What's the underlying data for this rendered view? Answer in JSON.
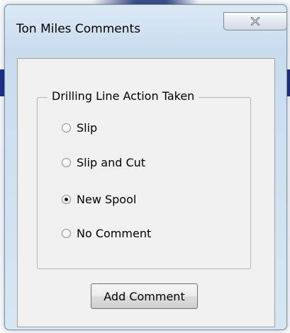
{
  "window": {
    "title": "Ton Miles Comments",
    "close_icon": "close-icon"
  },
  "group": {
    "label": "Drilling Line Action Taken",
    "options": [
      {
        "label": "Slip",
        "checked": false
      },
      {
        "label": "Slip and Cut",
        "checked": false
      },
      {
        "label": "New Spool",
        "checked": true
      },
      {
        "label": "No Comment",
        "checked": false
      }
    ]
  },
  "actions": {
    "add_comment_label": "Add Comment"
  },
  "colors": {
    "title_bar": "#c9dcee",
    "client_bg": "#f0f0f0",
    "desktop_accent": "#1f2f8a"
  }
}
